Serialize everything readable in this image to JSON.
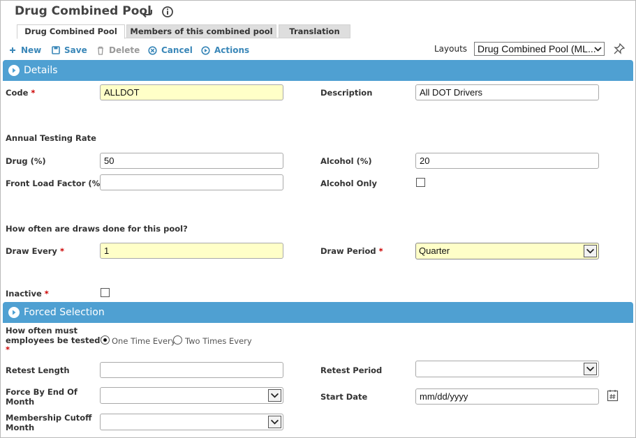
{
  "header": {
    "title": "Drug Combined Pool",
    "back_icon": "undo-arrow-icon",
    "info_icon": "info-icon"
  },
  "tabs": [
    {
      "label": "Drug Combined Pool",
      "active": true
    },
    {
      "label": "Members of this combined pool",
      "active": false
    },
    {
      "label": "Translation",
      "active": false
    }
  ],
  "toolbar": {
    "new_label": "New",
    "save_label": "Save",
    "delete_label": "Delete",
    "cancel_label": "Cancel",
    "actions_label": "Actions",
    "layouts_label": "Layouts",
    "layout_value": "Drug Combined Pool (ML...",
    "accent": "#3a87b8",
    "disabled": "#9a9a9a"
  },
  "details": {
    "section_title": "Details",
    "code_label": "Code",
    "code_value": "ALLDOT",
    "description_label": "Description",
    "description_value": "All DOT Drivers",
    "annual_heading": "Annual Testing Rate",
    "drug_label": "Drug (%)",
    "drug_value": "50",
    "alcohol_label": "Alcohol (%)",
    "alcohol_value": "20",
    "front_load_label": "Front Load Factor (%)",
    "front_load_value": "",
    "alcohol_only_label": "Alcohol Only",
    "alcohol_only_checked": false,
    "draws_heading": "How often are draws done for this pool?",
    "draw_every_label": "Draw Every",
    "draw_every_value": "1",
    "draw_period_label": "Draw Period",
    "draw_period_value": "Quarter",
    "inactive_label": "Inactive",
    "inactive_checked": false
  },
  "forced": {
    "section_title": "Forced Selection",
    "how_often_label_1": "How often must",
    "how_often_label_2": "employees be tested?",
    "option_one": "One Time Every",
    "option_two": "Two Times Every",
    "selected": "One Time Every",
    "retest_length_label": "Retest Length",
    "retest_length_value": "",
    "retest_period_label": "Retest Period",
    "retest_period_value": "",
    "force_by_label_1": "Force By End Of",
    "force_by_label_2": "Month",
    "force_by_value": "",
    "start_date_label": "Start Date",
    "start_date_placeholder": "mm/dd/yyyy",
    "cutoff_label_1": "Membership Cutoff",
    "cutoff_label_2": "Month",
    "cutoff_value": ""
  },
  "required_marker": "*",
  "colors": {
    "section_bar": "#4fa0d2",
    "required_bg": "#ffffc8",
    "required_star": "#cc0000"
  }
}
